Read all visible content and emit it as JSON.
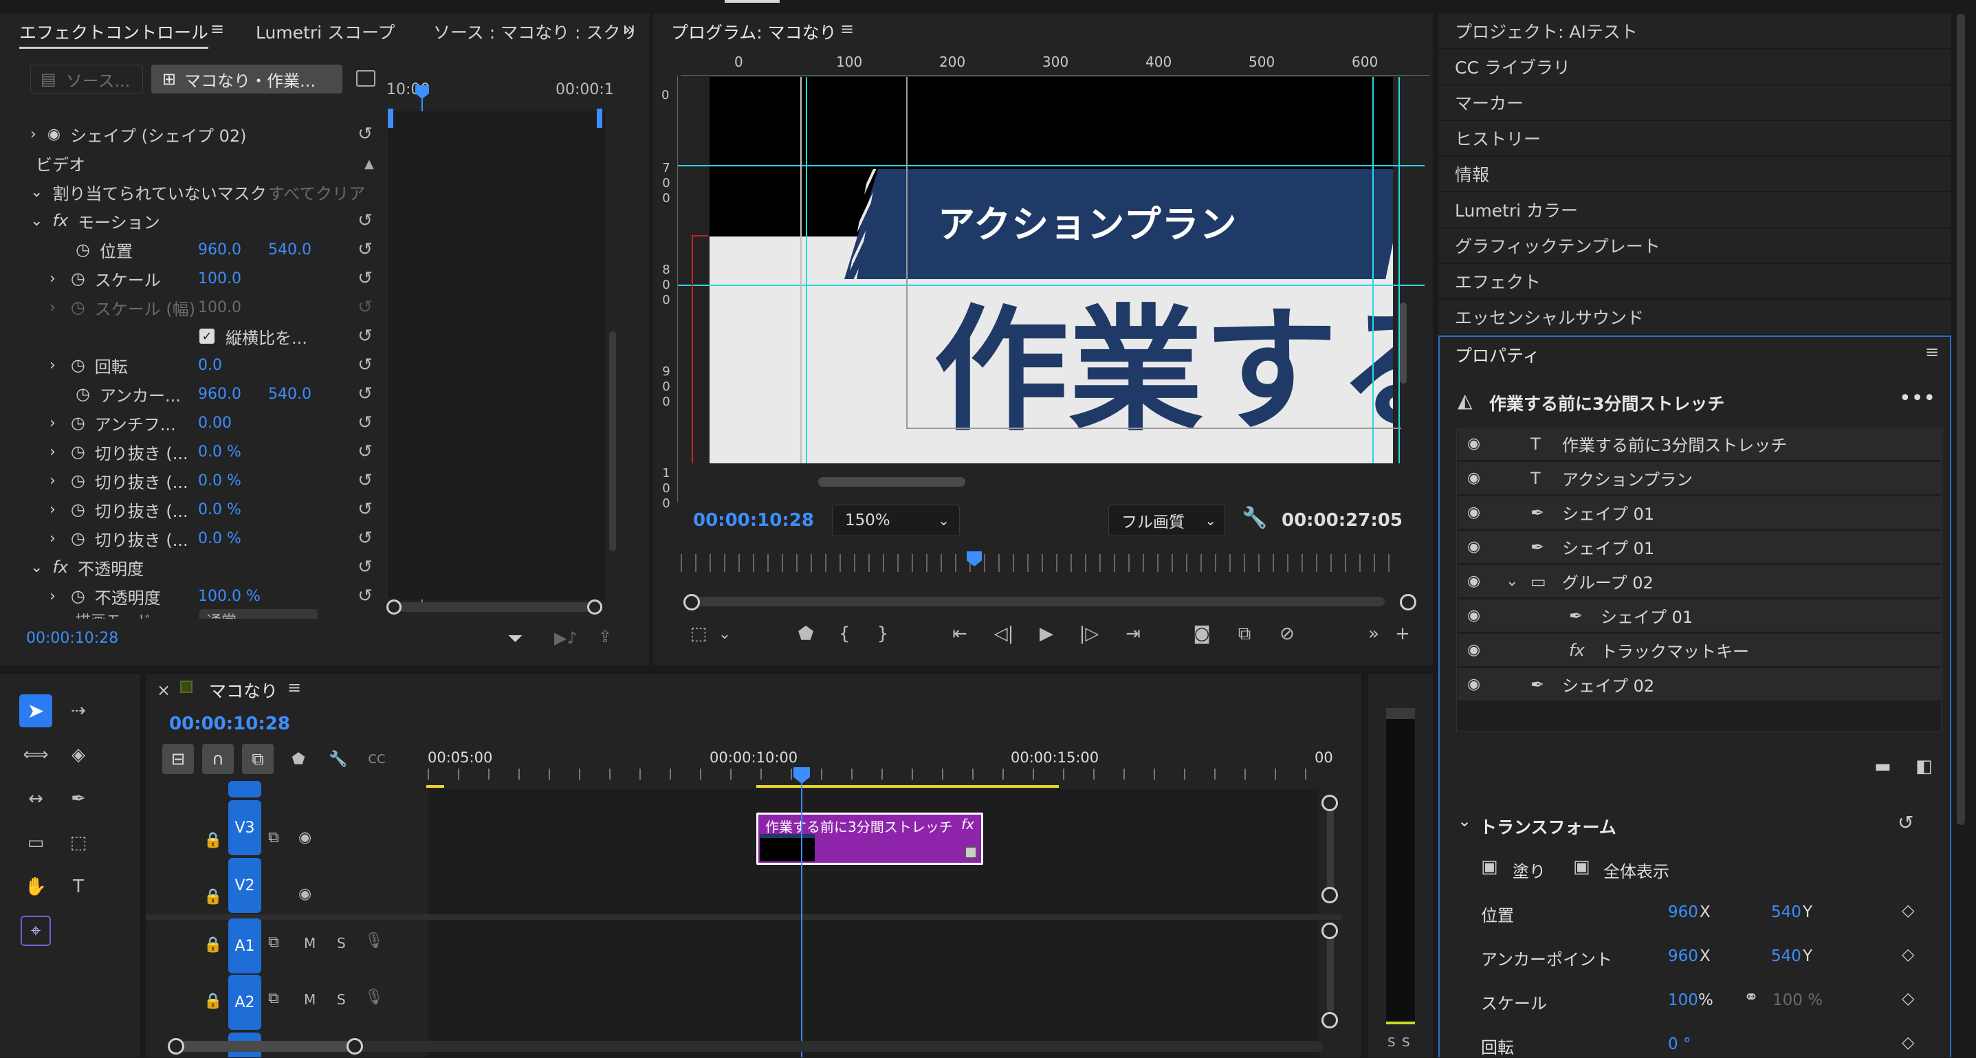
{
  "effect_controls": {
    "tabs": [
      "エフェクトコントロール",
      "Lumetri スコープ",
      "ソース : マコなり : スクリ"
    ],
    "source_chip": "ソース...",
    "seq_chip": "マコなり・作業...",
    "ruler_start": "10:00",
    "ruler_end": "00:00:1",
    "rows": {
      "shape02": "シェイプ (シェイプ 02)",
      "video": "ビデオ",
      "mask": "割り当てられていないマスク",
      "clear_all": "すべてクリア",
      "motion": "モーション",
      "position": "位置",
      "position_x": "960.0",
      "position_y": "540.0",
      "scale": "スケール",
      "scale_val": "100.0",
      "scale_w": "スケール (幅)",
      "scale_w_val": "100.0",
      "aspect": "縦横比を...",
      "rotation": "回転",
      "rotation_val": "0.0",
      "anchor": "アンカー...",
      "anchor_x": "960.0",
      "anchor_y": "540.0",
      "antiflicker": "アンチフ...",
      "antiflicker_val": "0.00",
      "crop1": "切り抜き (...",
      "crop2": "切り抜き (...",
      "crop3": "切り抜き (...",
      "crop4": "切り抜き (...",
      "crop_val": "0.0 %",
      "opacity_group": "不透明度",
      "opacity": "不透明度",
      "opacity_val": "100.0 %",
      "blend": "描画モード",
      "blend_val": "通常"
    },
    "timecode": "00:00:10:28"
  },
  "program": {
    "title": "プログラム: マコなり",
    "ruler_ticks": [
      "0",
      "100",
      "200",
      "300",
      "400",
      "500",
      "600"
    ],
    "vruler": [
      "0",
      "700",
      "800",
      "900",
      "100"
    ],
    "banner_text": "アクションプラン",
    "main_text": "作業する",
    "timecode": "00:00:10:28",
    "zoom": "150%",
    "quality": "フル画質",
    "duration": "00:00:27:05"
  },
  "right_panels": [
    "プロジェクト: AIテスト",
    "CC ライブラリ",
    "マーカー",
    "ヒストリー",
    "情報",
    "Lumetri カラー",
    "グラフィックテンプレート",
    "エフェクト",
    "エッセンシャルサウンド"
  ],
  "properties": {
    "title": "プロパティ",
    "clip_name": "作業する前に3分間ストレッチ",
    "layers": [
      {
        "name": "作業する前に3分間ストレッチ",
        "icon": "text-icon",
        "indent": 0
      },
      {
        "name": "アクションプラン",
        "icon": "text-icon",
        "indent": 0
      },
      {
        "name": "シェイプ 01",
        "icon": "pen-icon",
        "indent": 0
      },
      {
        "name": "シェイプ 01",
        "icon": "pen-icon",
        "indent": 0
      },
      {
        "name": "グループ 02",
        "icon": "folder-icon",
        "indent": 0
      },
      {
        "name": "シェイプ 01",
        "icon": "pen-icon",
        "indent": 1
      },
      {
        "name": "トラックマットキー",
        "icon": "fx-icon",
        "indent": 1
      },
      {
        "name": "シェイプ 02",
        "icon": "pen-icon",
        "indent": 0
      }
    ],
    "transform_title": "トランスフォーム",
    "fill_label": "塗り",
    "fullview_label": "全体表示",
    "position_label": "位置",
    "position_x": "960",
    "position_y": "540",
    "anchor_label": "アンカーポイント",
    "anchor_x": "960",
    "anchor_y": "540",
    "scale_label": "スケール",
    "scale_val": "100",
    "scale_val2": "100 %",
    "rotation_label": "回転",
    "rotation_val": "0 °",
    "x_unit": "X",
    "y_unit": "Y",
    "pct_unit": "%"
  },
  "timeline": {
    "seq_name": "マコなり",
    "timecode": "00:00:10:28",
    "ruler": [
      "00:05:00",
      "00:00:10:00",
      "00:00:15:00",
      "00"
    ],
    "clip_name": "作業する前に3分間ストレッチ",
    "clip_fx": "fx",
    "tracks": [
      "V3",
      "V2",
      "A1",
      "A2"
    ],
    "m": "M",
    "s": "S"
  },
  "meter_labels": "S S",
  "colors": {
    "accent": "#3d8eff",
    "clip": "#8e24aa",
    "banner": "#1f3a66"
  }
}
